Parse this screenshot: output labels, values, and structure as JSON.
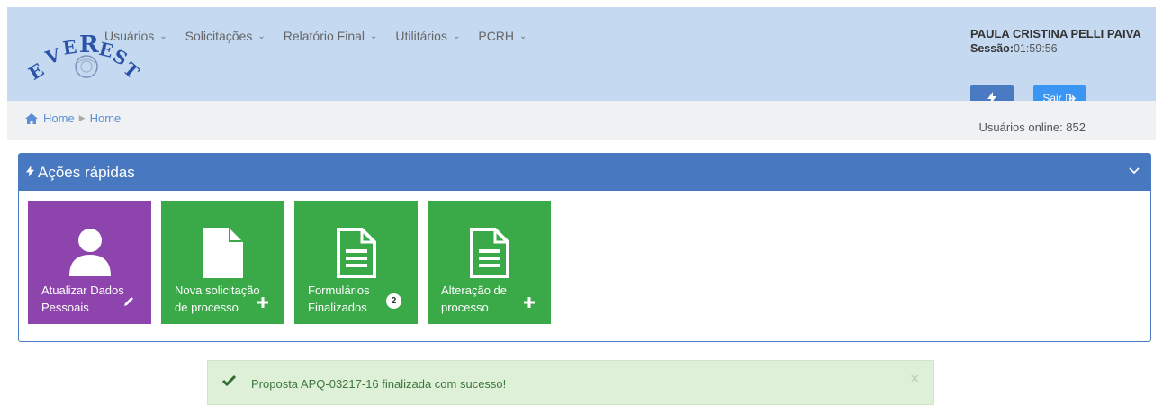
{
  "logo": {
    "text": "EVEREST"
  },
  "menu": [
    {
      "label": "Usuários"
    },
    {
      "label": "Solicitações"
    },
    {
      "label": "Relatório Final"
    },
    {
      "label": "Utilitários"
    },
    {
      "label": "PCRH"
    }
  ],
  "user": {
    "name": "PAULA CRISTINA PELLI PAIVA",
    "session_label": "Sessão:",
    "session_time": "01:59:56",
    "bolt_icon": "bolt-icon",
    "logout_label": "Sair"
  },
  "breadcrumb": {
    "items": [
      "Home",
      "Home"
    ]
  },
  "online": {
    "text": "Usuários online: 852"
  },
  "panel": {
    "title": "Ações rápidas",
    "tiles": [
      {
        "line1": "Atualizar Dados",
        "line2": "Pessoais",
        "color": "#8e44ad",
        "icon": "user-icon",
        "action": "pencil-icon"
      },
      {
        "line1": "Nova solicitação",
        "line2": "de processo",
        "color": "#3aaa48",
        "icon": "file-icon",
        "action": "plus-icon"
      },
      {
        "line1": "Formulários",
        "line2": "Finalizados",
        "color": "#3aaa48",
        "icon": "file-text-icon",
        "badge": "2"
      },
      {
        "line1": "Alteração de",
        "line2": "processo",
        "color": "#3aaa48",
        "icon": "file-text-icon",
        "action": "plus-icon"
      }
    ]
  },
  "alert": {
    "message": "Proposta APQ-03217-16 finalizada com sucesso!",
    "close": "×"
  },
  "colors": {
    "header_bg": "#c5d9f1",
    "panel_head": "#4878c0",
    "purple": "#8e44ad",
    "green": "#3aaa48",
    "alert_bg": "#dff0d8"
  }
}
